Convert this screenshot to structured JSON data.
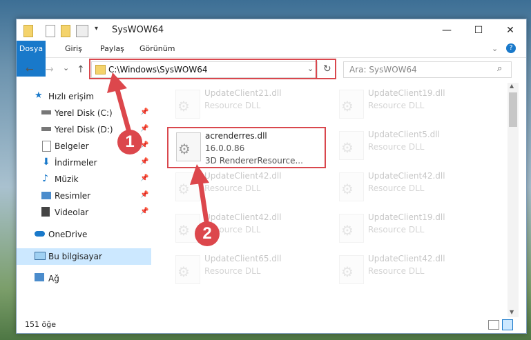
{
  "window": {
    "title": "SysWOW64",
    "minimize": "—",
    "maximize": "☐",
    "close": "✕"
  },
  "ribbon": {
    "tabs": [
      "Dosya",
      "Giriş",
      "Paylaş",
      "Görünüm"
    ]
  },
  "nav": {
    "back": "←",
    "forward": "→",
    "recent": "⌄",
    "up": "↑",
    "address": "C:\\Windows\\SysWOW64",
    "refresh": "↻",
    "search_placeholder": "Ara: SysWOW64"
  },
  "sidebar": {
    "items": [
      {
        "label": "Hızlı erişim",
        "icon": "star-icon",
        "pinned": false
      },
      {
        "label": "Yerel Disk (C:)",
        "icon": "drive-icon",
        "pinned": true
      },
      {
        "label": "Yerel Disk (D:)",
        "icon": "drive-icon",
        "pinned": true
      },
      {
        "label": "Belgeler",
        "icon": "documents-icon",
        "pinned": true
      },
      {
        "label": "İndirmeler",
        "icon": "download-icon",
        "pinned": true
      },
      {
        "label": "Müzik",
        "icon": "music-icon",
        "pinned": true
      },
      {
        "label": "Resimler",
        "icon": "pictures-icon",
        "pinned": true
      },
      {
        "label": "Videolar",
        "icon": "videos-icon",
        "pinned": true
      },
      {
        "label": "OneDrive",
        "icon": "cloud-icon",
        "pinned": false
      },
      {
        "label": "Bu bilgisayar",
        "icon": "computer-icon",
        "pinned": false
      },
      {
        "label": "Ağ",
        "icon": "network-icon",
        "pinned": false
      }
    ]
  },
  "files": {
    "highlighted": {
      "name": "acrenderres.dll",
      "version": "16.0.0.86",
      "description": "3D RendererResource..."
    },
    "left_column": [
      {
        "name": "UpdateClient21.dll",
        "desc": "Resource DLL"
      },
      {
        "name": "UpdateClient42.dll",
        "desc": "Resource DLL"
      },
      {
        "name": "UpdateClient42.dll",
        "desc": "Resource DLL"
      },
      {
        "name": "UpdateClient65.dll",
        "desc": "Resource DLL"
      }
    ],
    "right_column": [
      {
        "name": "UpdateClient19.dll",
        "desc": "Resource DLL"
      },
      {
        "name": "UpdateClient5.dll",
        "desc": "Resource DLL"
      },
      {
        "name": "UpdateClient42.dll",
        "desc": "Resource DLL"
      },
      {
        "name": "UpdateClient19.dll",
        "desc": "Resource DLL"
      },
      {
        "name": "UpdateClient42.dll",
        "desc": "Resource DLL"
      }
    ]
  },
  "status": {
    "count": "151 öğe"
  },
  "annotations": {
    "badge1": "1",
    "badge2": "2",
    "accent": "#dc474c"
  }
}
